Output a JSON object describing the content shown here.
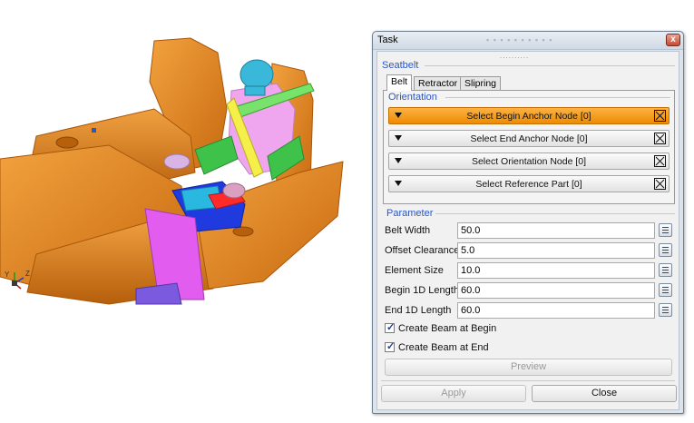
{
  "viewport": {
    "axes": {
      "y_label": "Y",
      "z_label": "Z"
    }
  },
  "task_window": {
    "title": "Task",
    "title_ghost": "▪ ▪ ▪ ▪ ▪ ▪ ▪ ▪ ▪ ▪",
    "close_glyph": "x",
    "grip": "..........",
    "section_title": "Seatbelt",
    "tabs": [
      {
        "label": "Belt",
        "active": true
      },
      {
        "label": "Retractor",
        "active": false
      },
      {
        "label": "Slipring",
        "active": false
      }
    ],
    "orientation": {
      "title": "Orientation",
      "selectors": [
        {
          "label": "Select Begin Anchor Node [0]",
          "active": true
        },
        {
          "label": "Select End Anchor Node [0]",
          "active": false
        },
        {
          "label": "Select Orientation Node [0]",
          "active": false
        },
        {
          "label": "Select Reference Part [0]",
          "active": false
        }
      ]
    },
    "parameter": {
      "title": "Parameter",
      "fields": [
        {
          "label": "Belt Width",
          "value": "50.0"
        },
        {
          "label": "Offset Clearance",
          "value": "5.0"
        },
        {
          "label": "Element Size",
          "value": "10.0"
        },
        {
          "label": "Begin 1D Length",
          "value": "60.0"
        },
        {
          "label": "End 1D Length",
          "value": "60.0"
        }
      ],
      "checkboxes": [
        {
          "label": "Create Beam at Begin",
          "checked": true
        },
        {
          "label": "Create Beam at End",
          "checked": true
        }
      ]
    },
    "preview_label": "Preview",
    "apply_label": "Apply",
    "close_label": "Close"
  },
  "colors": {
    "seat_orange": "#e8871f",
    "active_selector": "#f39a1a",
    "section_blue": "#2a56c6"
  }
}
